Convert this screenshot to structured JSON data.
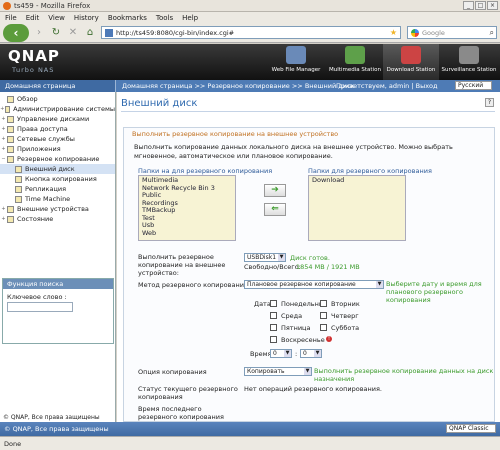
{
  "window_title": "ts459 - Mozilla Firefox",
  "menu": [
    "File",
    "Edit",
    "View",
    "History",
    "Bookmarks",
    "Tools",
    "Help"
  ],
  "url": "http://ts459:8080/cgi-bin/index.cgi#",
  "search_placeholder": "Google",
  "brand": {
    "logo": "QNAP",
    "sub": "Turbo NAS"
  },
  "banner_items": [
    "Web File Manager",
    "Multimedia Station",
    "Download Station",
    "Surveillance Station"
  ],
  "breadcrumb": {
    "nav_header": "Домашняя страница",
    "path": "Домашняя страница >> Резервное копирование >> Внешний диск",
    "user": "Приветствуем, admin | Выход",
    "language": "Русский"
  },
  "tree": [
    {
      "label": "Обзор",
      "level": 0,
      "exp": ""
    },
    {
      "label": "Администрирование системы",
      "level": 0,
      "exp": "+"
    },
    {
      "label": "Управление дисками",
      "level": 0,
      "exp": "+"
    },
    {
      "label": "Права доступа",
      "level": 0,
      "exp": "+"
    },
    {
      "label": "Сетевые службы",
      "level": 0,
      "exp": "+"
    },
    {
      "label": "Приложения",
      "level": 0,
      "exp": "+"
    },
    {
      "label": "Резервное копирование",
      "level": 0,
      "exp": "−"
    },
    {
      "label": "Внешний диск",
      "level": 1,
      "exp": "",
      "selected": true
    },
    {
      "label": "Кнопка копирования",
      "level": 1,
      "exp": ""
    },
    {
      "label": "Репликация",
      "level": 1,
      "exp": ""
    },
    {
      "label": "Time Machine",
      "level": 1,
      "exp": ""
    },
    {
      "label": "Внешние устройства",
      "level": 0,
      "exp": "+"
    },
    {
      "label": "Состояние",
      "level": 0,
      "exp": "+"
    }
  ],
  "search_panel": {
    "header": "Функция поиска",
    "label": "Ключевое слово :"
  },
  "footer": "© QNAP, Все права защищены",
  "main": {
    "title": "Внешний диск",
    "section_header": "Выполнить резервное копирование на внешнее устройство",
    "description": "Выполнить копирование данных локального диска на внешнее устройство. Можно выбрать мгновенное, автоматическое или плановое копирование.",
    "src_label": "Папки на для резервного копирования",
    "dst_label": "Папки для резервного копирования",
    "src_folders": [
      "Multimedia",
      "Network Recycle Bin 3",
      "Public",
      "Recordings",
      "TMBackup",
      "Test",
      "Usb",
      "Web"
    ],
    "dst_folders": [
      "Download"
    ],
    "target_label": "Выполнить резервное копирование на внешнее устройство:",
    "target_value": "USBDisk1",
    "disk_status": "Диск готов.",
    "free_label": "Свободно/Всего:",
    "free_value": "1854 MB / 1921 MB",
    "method_label": "Метод резервного копирования",
    "method_value": "Плановое резервное копирование",
    "method_hint": "Выберите дату и время для планового резервного копирования",
    "date_label": "Дата:",
    "days": [
      "Понедельник",
      "Вторник",
      "Среда",
      "Четверг",
      "Пятница",
      "Суббота",
      "Воскресенье"
    ],
    "time_label": "Время:",
    "time_h": "0",
    "time_m": "0",
    "copy_opt_label": "Опция копирования",
    "copy_opt_value": "Копировать",
    "copy_opt_hint": "Выполнить резервное копирование данных на диск назначения",
    "status_label": "Статус текущего резервного копирования",
    "status_value": "Нет операций резервного копирования.",
    "last_label": "Время последнего резервного копирования"
  },
  "taskbar_right": "QNAP Classic",
  "status": "Done"
}
